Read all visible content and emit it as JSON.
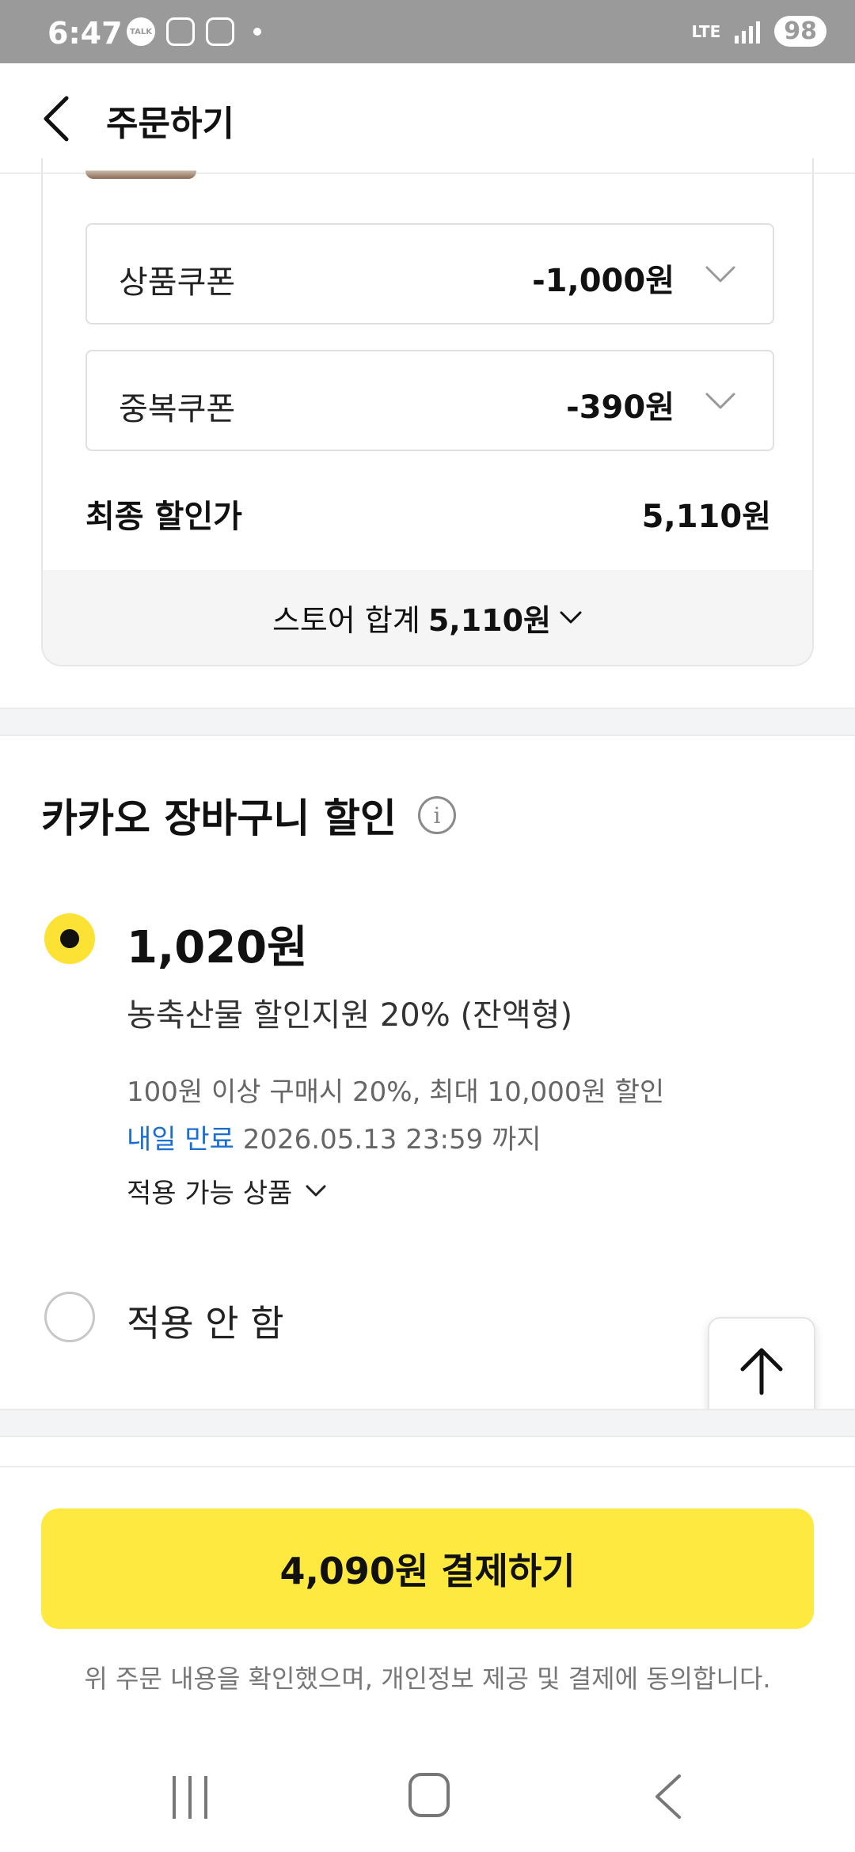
{
  "status_bar": {
    "time": "6:47",
    "talk_label": "TALK",
    "network": "LTE",
    "battery": "98"
  },
  "header": {
    "title": "주문하기"
  },
  "coupons": [
    {
      "label": "상품쿠폰",
      "value": "-1,000원"
    },
    {
      "label": "중복쿠폰",
      "value": "-390원"
    }
  ],
  "final_price": {
    "label": "최종 할인가",
    "value": "5,110원"
  },
  "store_total": {
    "label": "스토어 합계",
    "amount": "5,110원"
  },
  "kakao_discount": {
    "title": "카카오 장바구니 할인",
    "info_glyph": "i",
    "option": {
      "amount": "1,020원",
      "name": "농축산물 할인지원 20% (잔액형)",
      "condition": "100원 이상 구매시 20%, 최대 10,000원 할인",
      "expiry_soon": "내일 만료",
      "expiry_date": "2026.05.13 23:59 까지",
      "applicable_label": "적용 가능 상품",
      "selected": true
    },
    "no_apply": {
      "label": "적용 안 함",
      "selected": false
    }
  },
  "payment": {
    "button_label": "4,090원 결제하기",
    "agreement": "위 주문 내용을 확인했으며, 개인정보 제공 및 결제에 동의합니다."
  },
  "colors": {
    "accent_yellow": "#fee941",
    "radio_yellow": "#fde236",
    "link_blue": "#1a6fd1",
    "status_bar_gray": "#9a9a9a"
  },
  "icons": {
    "back": "chevron-left-icon",
    "dropdown": "chevron-down-icon",
    "info": "info-icon",
    "scroll_top": "arrow-up-icon"
  }
}
